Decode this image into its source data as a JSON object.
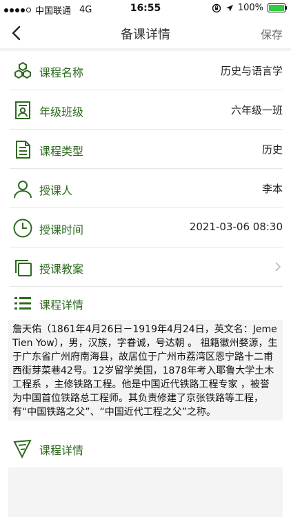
{
  "status_bar": {
    "carrier": "中国联通",
    "network": "4G",
    "time": "16:55",
    "battery": "100%",
    "battery_level": 1.0
  },
  "nav": {
    "title": "备课详情",
    "save_label": "保存"
  },
  "rows": [
    {
      "label": "课程名称",
      "value": "历史与语言学",
      "icon": "hexagon-cluster-icon"
    },
    {
      "label": "年级班级",
      "value": "六年级一班",
      "icon": "person-document-icon"
    },
    {
      "label": "课程类型",
      "value": "历史",
      "icon": "document-list-icon"
    },
    {
      "label": "授课人",
      "value": "李本",
      "icon": "user-icon"
    },
    {
      "label": "授课时间",
      "value": "2021-03-06 08:30",
      "icon": "clock-icon"
    },
    {
      "label": "授课教案",
      "value": "",
      "icon": "copy-icon"
    }
  ],
  "detail_section": {
    "label": "课程详情",
    "icon": "list-icon",
    "text": "詹天佑（1861年4月26日－1919年4月24日，英文名：Jeme Tien Yow），男，汉族，字眷诚，号达朝 。 祖籍徽州婺源，生于广东省广州府南海县，故居位于广州市荔湾区恩宁路十二甫西街芽菜巷42号。12岁留学美国，1878年考入耶鲁大学土木工程系 ，主修铁路工程。他是中国近代铁路工程专家 ，被誉为中国首位铁路总工程师。其负责修建了京张铁路等工程，有“中国铁路之父”、“中国近代工程之父”之称。"
  },
  "second_section": {
    "label": "课程详情",
    "icon": "cone-pen-icon"
  },
  "colors": {
    "accent_green": "#2d6a1f",
    "background_gray": "#f4f4f4"
  }
}
